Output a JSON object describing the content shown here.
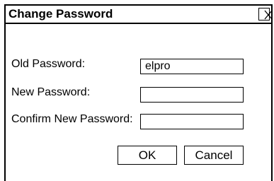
{
  "dialog": {
    "title": "Change Password",
    "close_label": "X"
  },
  "fields": {
    "old_password": {
      "label": "Old Password:",
      "value": "elpro"
    },
    "new_password": {
      "label": "New Password:",
      "value": ""
    },
    "confirm_password": {
      "label": "Confirm New Password:",
      "value": ""
    }
  },
  "buttons": {
    "ok_label": "OK",
    "cancel_label": "Cancel"
  }
}
